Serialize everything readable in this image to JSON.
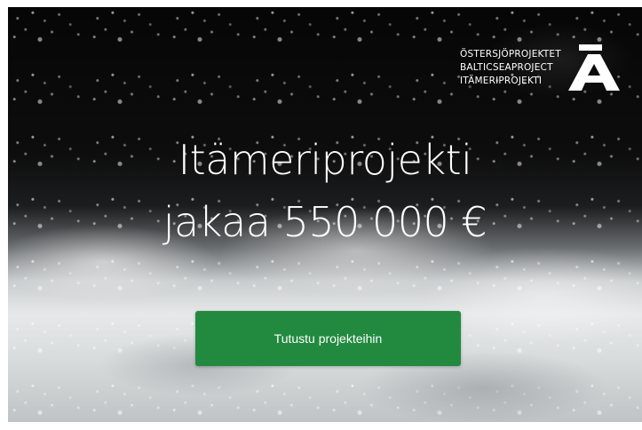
{
  "logo": {
    "lines": [
      "ÖSTERSJÖPROJEKTET",
      "BALTICSEAPROJECT",
      "ITÄMERIPROJEKTI"
    ],
    "icon": "a-ring-logo-icon"
  },
  "headline": {
    "line1": "Itämeriprojekti",
    "line2": "jakaa 550 000 €"
  },
  "cta": {
    "label": "Tutustu projekteihin"
  },
  "colors": {
    "cta_background": "#218a3f",
    "text": "#ffffff"
  }
}
